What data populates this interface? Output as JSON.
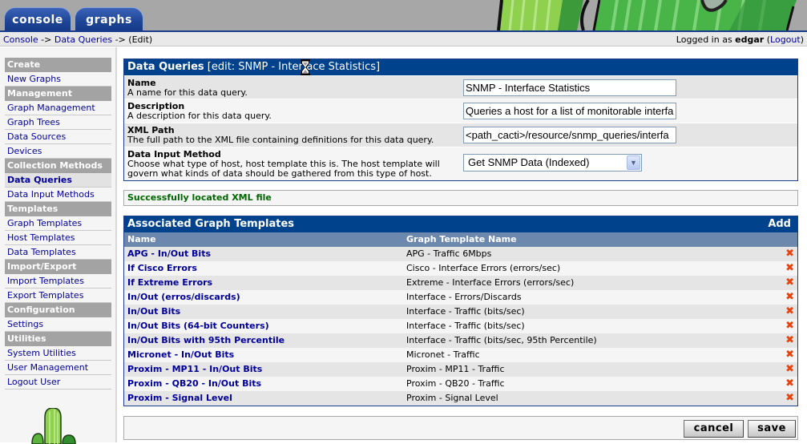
{
  "header": {
    "tabs": [
      {
        "label": "console",
        "active": true
      },
      {
        "label": "graphs",
        "active": false
      }
    ],
    "breadcrumb": [
      {
        "label": "Console",
        "link": true
      },
      {
        "label": "Data Queries",
        "link": true
      },
      {
        "label": "(Edit)",
        "link": false
      }
    ],
    "breadcrumb_separator": "->",
    "login": {
      "prefix": "Logged in as",
      "user": "edgar",
      "logout_label": "Logout"
    }
  },
  "sidebar": {
    "sections": [
      {
        "header": "Create",
        "items": [
          {
            "label": "New Graphs"
          }
        ]
      },
      {
        "header": "Management",
        "items": [
          {
            "label": "Graph Management"
          },
          {
            "label": "Graph Trees"
          },
          {
            "label": "Data Sources"
          },
          {
            "label": "Devices"
          }
        ]
      },
      {
        "header": "Collection Methods",
        "items": [
          {
            "label": "Data Queries",
            "active": true
          },
          {
            "label": "Data Input Methods"
          }
        ]
      },
      {
        "header": "Templates",
        "items": [
          {
            "label": "Graph Templates"
          },
          {
            "label": "Host Templates"
          },
          {
            "label": "Data Templates"
          }
        ]
      },
      {
        "header": "Import/Export",
        "items": [
          {
            "label": "Import Templates"
          },
          {
            "label": "Export Templates"
          }
        ]
      },
      {
        "header": "Configuration",
        "items": [
          {
            "label": "Settings"
          }
        ]
      },
      {
        "header": "Utilities",
        "items": [
          {
            "label": "System Utilities"
          },
          {
            "label": "User Management"
          },
          {
            "label": "Logout User"
          }
        ]
      }
    ]
  },
  "form": {
    "title": "Data Queries",
    "subtitle": "[edit: SNMP - Interface Statistics]",
    "fields": [
      {
        "label": "Name",
        "description": "A name for this data query.",
        "value": "SNMP - Interface Statistics",
        "type": "text"
      },
      {
        "label": "Description",
        "description": "A description for this data query.",
        "value": "Queries a host for a list of monitorable interfa",
        "type": "text"
      },
      {
        "label": "XML Path",
        "description": "The full path to the XML file containing definitions for this data query.",
        "value": "<path_cacti>/resource/snmp_queries/interfa",
        "type": "text"
      },
      {
        "label": "Data Input Method",
        "description": "Choose what type of host, host template this is. The host template will govern what kinds of data should be gathered from this type of host.",
        "value": "Get SNMP Data (Indexed)",
        "type": "select"
      }
    ]
  },
  "status_message": "Successfully located XML file",
  "graph_templates": {
    "title": "Associated Graph Templates",
    "add_label": "Add",
    "columns": [
      "Name",
      "Graph Template Name"
    ],
    "rows": [
      {
        "name": "APG - In/Out Bits",
        "template": "APG - Traffic 6Mbps"
      },
      {
        "name": "If Cisco Errors",
        "template": "Cisco - Interface Errors (errors/sec)"
      },
      {
        "name": "If Extreme Errors",
        "template": "Extreme - Interface Errors (errors/sec)"
      },
      {
        "name": "In/Out (erros/discards)",
        "template": "Interface - Errors/Discards"
      },
      {
        "name": "In/Out Bits",
        "template": "Interface - Traffic (bits/sec)"
      },
      {
        "name": "In/Out Bits (64-bit Counters)",
        "template": "Interface - Traffic (bits/sec)"
      },
      {
        "name": "In/Out Bits with 95th Percentile",
        "template": "Interface - Traffic (bits/sec, 95th Percentile)"
      },
      {
        "name": "Micronet - In/Out Bits",
        "template": "Micronet - Traffic"
      },
      {
        "name": "Proxim - MP11 - In/Out Bits",
        "template": "Proxim - MP11 - Traffic"
      },
      {
        "name": "Proxim - QB20 - In/Out Bits",
        "template": "Proxim - QB20 - Traffic"
      },
      {
        "name": "Proxim - Signal Level",
        "template": "Proxim - Signal Level"
      }
    ],
    "delete_icon": "red-x-icon"
  },
  "buttons": {
    "cancel_label": "cancel",
    "save_label": "save"
  },
  "colors": {
    "panel_header": "#00438c",
    "column_header": "#6d88ad",
    "link": "#000099",
    "success": "#006600",
    "delete": "#e8420f"
  }
}
